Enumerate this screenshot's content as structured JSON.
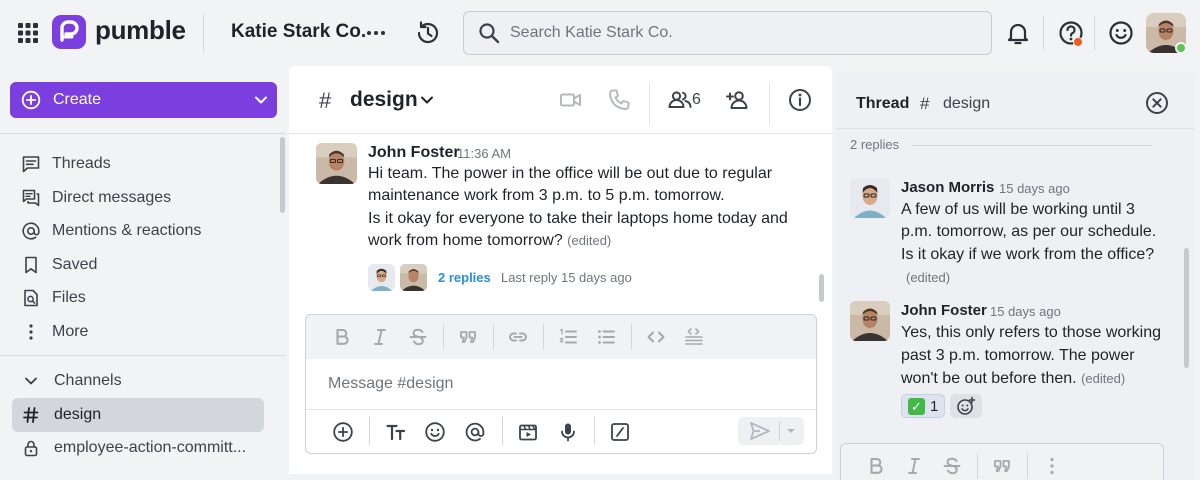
{
  "app": {
    "brand": "pumble",
    "workspace": "Katie Stark Co."
  },
  "search": {
    "placeholder": "Search Katie Stark Co."
  },
  "colors": {
    "accent": "#7b3fe0",
    "link": "#2c8fd6",
    "notification": "#f05a22",
    "online": "#5fc255"
  },
  "sidebar": {
    "create_label": "Create",
    "items": [
      {
        "label": "Threads",
        "icon": "threads-icon"
      },
      {
        "label": "Direct messages",
        "icon": "direct-messages-icon"
      },
      {
        "label": "Mentions & reactions",
        "icon": "at-icon"
      },
      {
        "label": "Saved",
        "icon": "bookmark-icon"
      },
      {
        "label": "Files",
        "icon": "files-icon"
      },
      {
        "label": "More",
        "icon": "more-vertical-icon"
      }
    ],
    "channels_label": "Channels",
    "channels": [
      {
        "name": "design",
        "icon": "hash-icon",
        "active": true
      },
      {
        "name": "employee-action-committ...",
        "icon": "lock-icon",
        "active": false
      }
    ]
  },
  "channel": {
    "hash": "#",
    "name": "design",
    "member_count": "6",
    "message": {
      "author": "John Foster",
      "time": "11:36 AM",
      "lines": [
        "Hi team. The power in the office will be out due to regular",
        "maintenance work from 3 p.m. to 5 p.m. tomorrow.",
        "Is it okay for everyone to take their laptops home today and",
        "work from home tomorrow?"
      ],
      "edited": "(edited)",
      "replies": "2 replies",
      "last_reply": "Last reply 15 days ago"
    },
    "composer": {
      "placeholder": "Message #design"
    }
  },
  "thread": {
    "title": "Thread",
    "hash": "#",
    "channel": "design",
    "replies_count": "2 replies",
    "messages": [
      {
        "author": "Jason Morris",
        "time": "15 days ago",
        "lines": [
          "A few of us will be working until 3",
          "p.m. tomorrow, as per our schedule.",
          "Is it okay if we work from the office?"
        ],
        "edited": "(edited)"
      },
      {
        "author": "John Foster",
        "time": "15 days ago",
        "lines": [
          "Yes, this only refers to those working",
          "past 3 p.m. tomorrow. The power",
          "won't be out before then."
        ],
        "edited": "(edited)",
        "reaction": {
          "emoji": "✓",
          "count": "1"
        }
      }
    ]
  }
}
